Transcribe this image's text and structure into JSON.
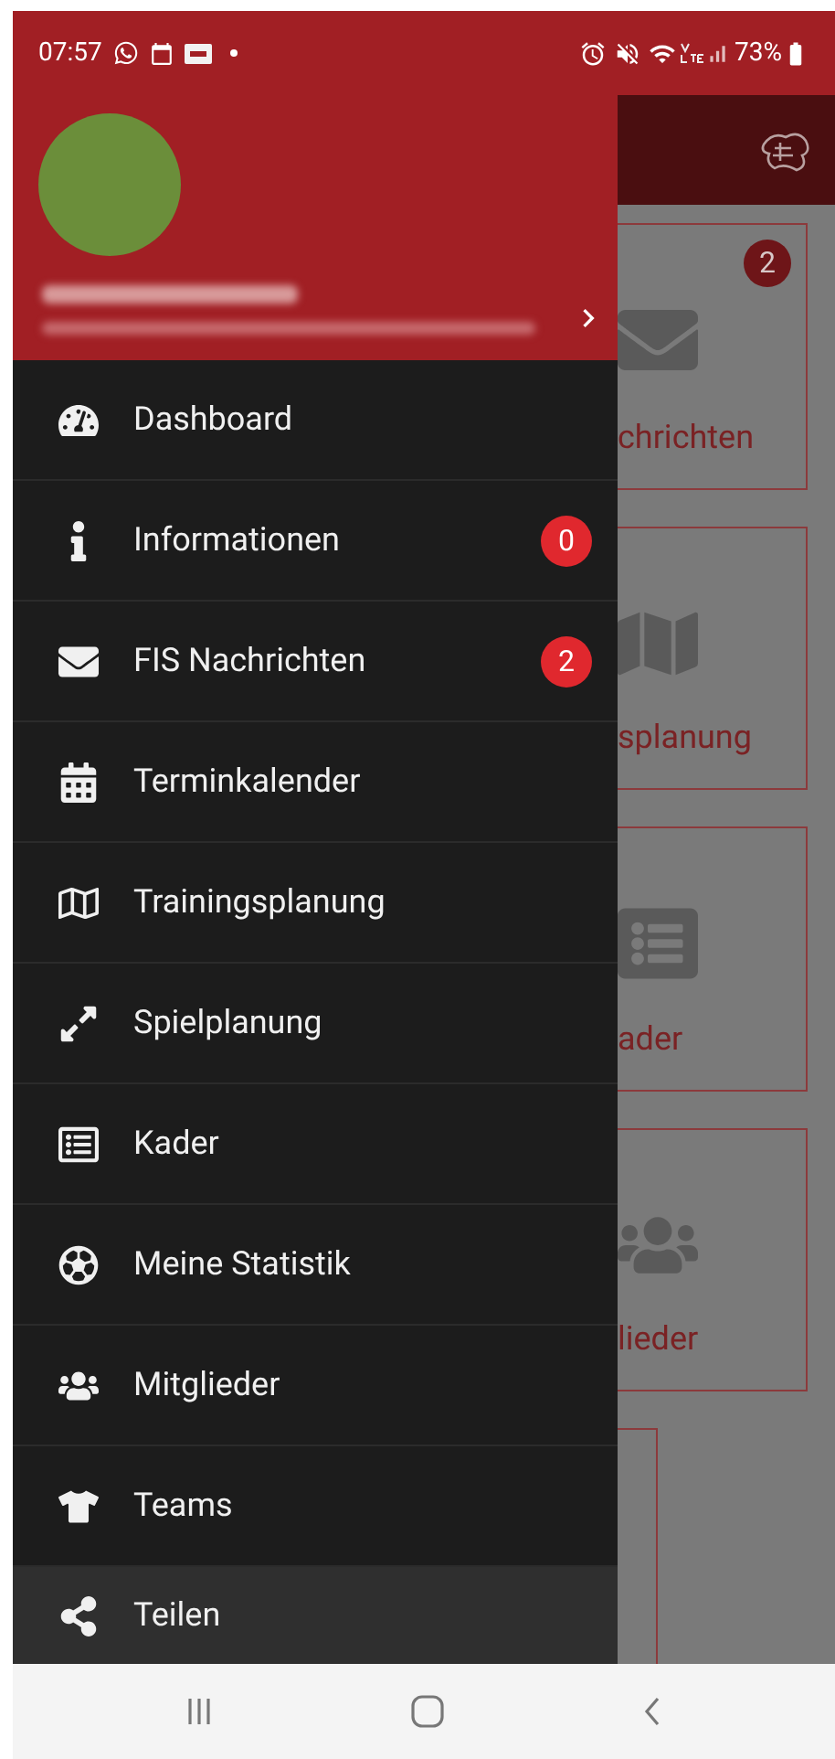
{
  "status_bar": {
    "time": "07:57",
    "battery": "73%"
  },
  "drawer": {
    "menu": [
      {
        "label": "Dashboard",
        "selected": false
      },
      {
        "label": "Informationen",
        "badge": "0",
        "selected": false
      },
      {
        "label": "FIS Nachrichten",
        "badge": "2",
        "selected": false
      },
      {
        "label": "Terminkalender",
        "selected": false
      },
      {
        "label": "Trainingsplanung",
        "selected": false
      },
      {
        "label": "Spielplanung",
        "selected": false
      },
      {
        "label": "Kader",
        "selected": false
      },
      {
        "label": "Meine Statistik",
        "selected": false
      },
      {
        "label": "Mitglieder",
        "selected": false
      },
      {
        "label": "Teams",
        "selected": false
      },
      {
        "label": "Teilen",
        "selected": true
      }
    ]
  },
  "background_tiles": [
    {
      "label": "chrichten",
      "badge": "2"
    },
    {
      "label": "splanung"
    },
    {
      "label": "ader"
    },
    {
      "label": "lieder"
    }
  ]
}
